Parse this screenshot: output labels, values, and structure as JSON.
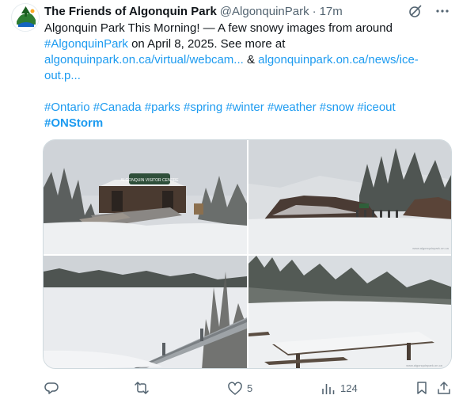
{
  "tweet": {
    "author_name": "The Friends of Algonquin Park",
    "handle": "@AlgonquinPark",
    "separator": "·",
    "time": "17m",
    "text_line1": "Algonquin Park This Morning! — A few snowy images from around",
    "hashtag_park": "#AlgonquinPark",
    "text_line2_rest": " on April 8, 2025. See more at",
    "link_webcam": "algonquinpark.on.ca/virtual/webcam...",
    "text_amp": " & ",
    "link_iceout_part1": "algonquinpark.on.ca/news/ice-",
    "link_iceout_part2": "out.p...",
    "hashtags": [
      "#Ontario",
      "#Canada",
      "#parks",
      "#spring",
      "#winter",
      "#weather",
      "#snow",
      "#iceout"
    ],
    "hashtag_bold": "#ONStorm"
  },
  "media": {
    "photo1_sign_text": "ALGONQUIN VISITOR CENTRE",
    "watermark": "www.algonquinpark.on.ca"
  },
  "actions": {
    "replies": "",
    "reposts": "",
    "likes": "5",
    "views": "124"
  },
  "icons": {
    "avatar": "friends-of-algonquin-logo",
    "grok": "grok-icon",
    "more": "more-icon",
    "reply": "reply-icon",
    "repost": "repost-icon",
    "like": "heart-icon",
    "views": "views-icon",
    "bookmark": "bookmark-icon",
    "share": "share-icon"
  },
  "colors": {
    "link": "#1d9bf0",
    "text": "#0f1419",
    "muted": "#536471",
    "border": "#cfd9de"
  }
}
